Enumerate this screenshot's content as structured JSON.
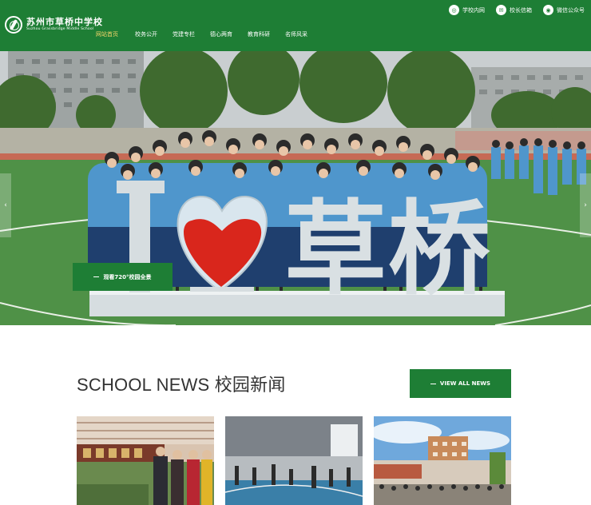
{
  "header": {
    "logo": {
      "cn": "苏州市草桥中学校",
      "en": "Suzhou Grassbridge Middle School"
    },
    "nav": [
      {
        "label": "网站首页",
        "active": true
      },
      {
        "label": "校务公开",
        "active": false
      },
      {
        "label": "党建专栏",
        "active": false
      },
      {
        "label": "德心两育",
        "active": false
      },
      {
        "label": "教育科研",
        "active": false
      },
      {
        "label": "名师风采",
        "active": false
      }
    ],
    "top_links": [
      {
        "label": "学校内网",
        "icon": "globe-icon"
      },
      {
        "label": "校长信箱",
        "icon": "mailbox-icon"
      },
      {
        "label": "微信公众号",
        "icon": "wechat-icon"
      }
    ]
  },
  "hero": {
    "sign_char1": "草",
    "sign_char2": "桥",
    "tour_button": "观看720°校园全景"
  },
  "news": {
    "title": "SCHOOL NEWS 校园新闻",
    "view_all": "VIEW ALL NEWS"
  },
  "colors": {
    "brand_green": "#1e7e35",
    "active_nav": "#f5d56a"
  }
}
